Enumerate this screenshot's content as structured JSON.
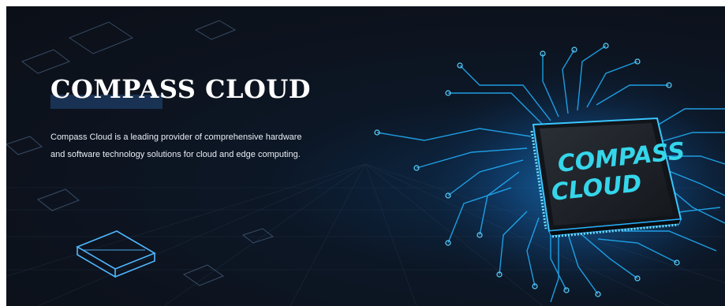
{
  "hero": {
    "title": "COMPASS CLOUD",
    "description": "Compass Cloud is a leading provider of comprehensive hardware and software technology solutions for cloud and edge computing."
  },
  "chip": {
    "label_line1": "COMPASS",
    "label_line2": "CLOUD"
  },
  "colors": {
    "background": "#0d131e",
    "circuit_glow": "#1ea8ff",
    "chip_text": "#35d6ea",
    "title_underline": "#1d3d66"
  }
}
